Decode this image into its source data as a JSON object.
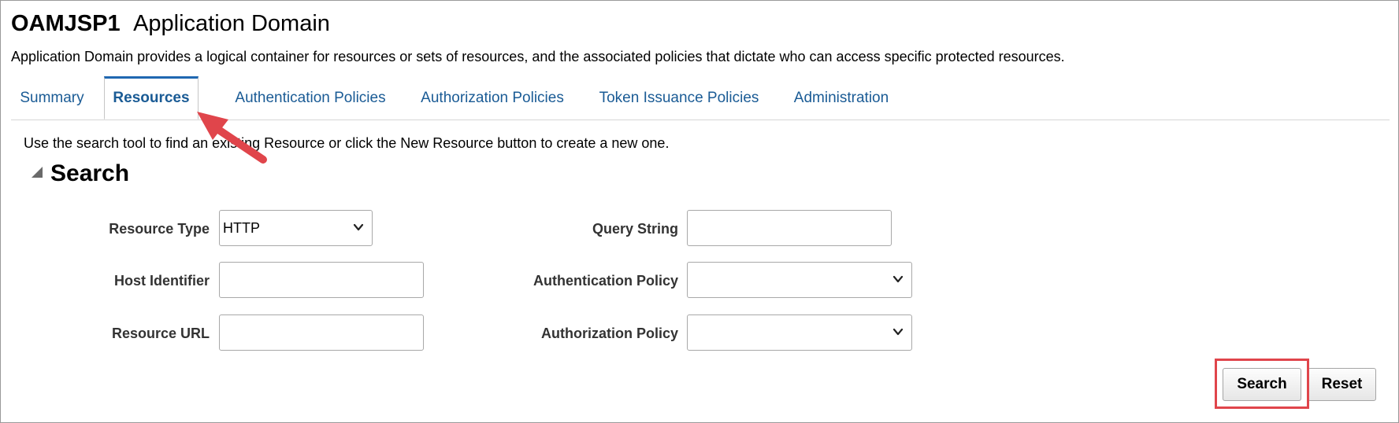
{
  "header": {
    "app_name": "OAMJSP1",
    "page_title": "Application Domain",
    "description": "Application Domain provides a logical container for resources or sets of resources, and the associated policies that dictate who can access specific protected resources."
  },
  "tabs": [
    {
      "label": "Summary",
      "active": false
    },
    {
      "label": "Resources",
      "active": true
    },
    {
      "label": "Authentication Policies",
      "active": false
    },
    {
      "label": "Authorization Policies",
      "active": false
    },
    {
      "label": "Token Issuance Policies",
      "active": false
    },
    {
      "label": "Administration",
      "active": false
    }
  ],
  "hint_text": "Use the search tool to find an existing Resource or click the New Resource button to create a new one.",
  "search": {
    "section_title": "Search",
    "disclosure_icon": "triangle-expanded-icon",
    "fields": {
      "resource_type": {
        "label": "Resource Type",
        "value": "HTTP"
      },
      "host_identifier": {
        "label": "Host Identifier",
        "value": ""
      },
      "resource_url": {
        "label": "Resource URL",
        "value": ""
      },
      "query_string": {
        "label": "Query String",
        "value": ""
      },
      "authentication_policy": {
        "label": "Authentication Policy",
        "value": ""
      },
      "authorization_policy": {
        "label": "Authorization Policy",
        "value": ""
      }
    },
    "buttons": {
      "search": "Search",
      "reset": "Reset"
    }
  },
  "colors": {
    "tab_link": "#1a5b95",
    "active_tab_border": "#1f67b1",
    "annotation_red": "#e0454b"
  }
}
